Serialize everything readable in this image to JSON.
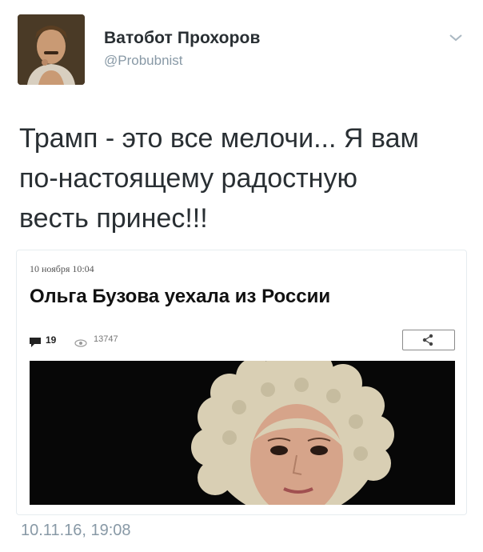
{
  "author": {
    "name": "Ватобот Прохоров",
    "handle": "@Probubnist"
  },
  "tweet": {
    "text": "Трамп - это все мелочи... Я вам\nпо-настоящему радостную\nвесть принес!!!",
    "timestamp": "10.11.16, 19:08"
  },
  "card": {
    "date": "10 ноября 10:04",
    "title": "Ольга Бузова уехала из России",
    "comments": "19",
    "views": "13747"
  },
  "icons": {
    "menu": "chevron-down-icon",
    "comments": "comment-bubble-icon",
    "views": "eye-icon",
    "share": "share-icon"
  },
  "colors": {
    "text": "#292f33",
    "secondary": "#8899a6",
    "card_border": "#e6ecf0"
  }
}
